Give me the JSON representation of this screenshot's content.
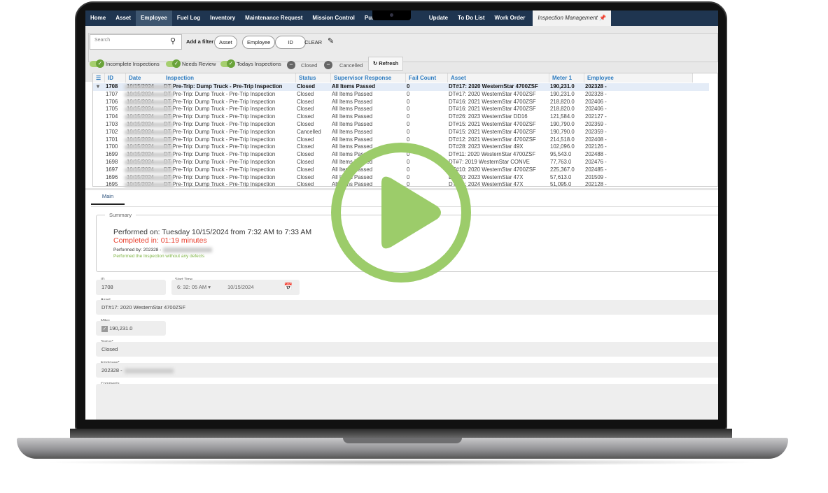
{
  "nav": {
    "items": [
      "Home",
      "Asset",
      "Employee",
      "Fuel Log",
      "Inventory",
      "Maintenance Request",
      "Mission Control",
      "Purchase",
      "Update",
      "To Do List",
      "Work Order"
    ],
    "active_tab": "Inspection Management",
    "selected": "Employee"
  },
  "filters": {
    "search_placeholder": "Search",
    "add_filter": "Add a filter",
    "chips": [
      "Asset",
      "Employee",
      "ID"
    ],
    "clear": "CLEAR",
    "toggles": [
      {
        "label": "Incomplete Inspections",
        "on": true
      },
      {
        "label": "Needs Review",
        "on": true
      },
      {
        "label": "Todays Inspections",
        "on": true
      },
      {
        "label": "Closed",
        "on": false
      },
      {
        "label": "Cancelled",
        "on": false
      }
    ],
    "refresh": "Refresh"
  },
  "grid": {
    "columns": [
      "ID",
      "Date",
      "Inspection",
      "Status",
      "Supervisor Response",
      "Fail Count",
      "Asset",
      "Meter 1",
      "Employee"
    ],
    "rows": [
      [
        "1708",
        "10/15/2024",
        "DT Pre-Trip: Dump Truck - Pre-Trip Inspection",
        "Closed",
        "All Items Passed",
        "0",
        "DT#17: 2020 WesternStar 4700ZSF",
        "190,231.0",
        "202328 -"
      ],
      [
        "1707",
        "10/15/2024",
        "DT Pre-Trip: Dump Truck - Pre-Trip Inspection",
        "Closed",
        "All Items Passed",
        "0",
        "DT#17: 2020 WesternStar 4700ZSF",
        "190,231.0",
        "202328 -"
      ],
      [
        "1706",
        "10/15/2024",
        "DT Pre-Trip: Dump Truck - Pre-Trip Inspection",
        "Closed",
        "All Items Passed",
        "0",
        "DT#16: 2021 WesternStar 4700ZSF",
        "218,820.0",
        "202406 -"
      ],
      [
        "1705",
        "10/15/2024",
        "DT Pre-Trip: Dump Truck - Pre-Trip Inspection",
        "Closed",
        "All Items Passed",
        "0",
        "DT#16: 2021 WesternStar 4700ZSF",
        "218,820.0",
        "202406 -"
      ],
      [
        "1704",
        "10/15/2024",
        "DT Pre-Trip: Dump Truck - Pre-Trip Inspection",
        "Closed",
        "All Items Passed",
        "0",
        "DT#26: 2023 WesternStar DD16",
        "121,584.0",
        "202127 -"
      ],
      [
        "1703",
        "10/15/2024",
        "DT Pre-Trip: Dump Truck - Pre-Trip Inspection",
        "Closed",
        "All Items Passed",
        "0",
        "DT#15: 2021 WesternStar 4700ZSF",
        "190,790.0",
        "202359 -"
      ],
      [
        "1702",
        "10/15/2024",
        "DT Pre-Trip: Dump Truck - Pre-Trip Inspection",
        "Cancelled",
        "All Items Passed",
        "0",
        "DT#15: 2021 WesternStar 4700ZSF",
        "190,790.0",
        "202359 -"
      ],
      [
        "1701",
        "10/15/2024",
        "DT Pre-Trip: Dump Truck - Pre-Trip Inspection",
        "Closed",
        "All Items Passed",
        "0",
        "DT#12: 2021 WesternStar 4700ZSF",
        "214,518.0",
        "202408 -"
      ],
      [
        "1700",
        "10/15/2024",
        "DT Pre-Trip: Dump Truck - Pre-Trip Inspection",
        "Closed",
        "All Items Passed",
        "0",
        "DT#28: 2023 WesternStar 49X",
        "102,096.0",
        "202126 -"
      ],
      [
        "1699",
        "10/15/2024",
        "DT Pre-Trip: Dump Truck - Pre-Trip Inspection",
        "Closed",
        "All Items Passed",
        "0",
        "DT#11: 2020 WesternStar 4700ZSF",
        "95,543.0",
        "202488 -"
      ],
      [
        "1698",
        "10/15/2024",
        "DT Pre-Trip: Dump Truck - Pre-Trip Inspection",
        "Closed",
        "All Items Passed",
        "0",
        "DT#7: 2019 WesternStar CONVE",
        "77,763.0",
        "202476 -"
      ],
      [
        "1697",
        "10/15/2024",
        "DT Pre-Trip: Dump Truck - Pre-Trip Inspection",
        "Closed",
        "All Items Passed",
        "0",
        "DT#10: 2020 WesternStar 4700ZSF",
        "225,367.0",
        "202485 -"
      ],
      [
        "1696",
        "10/15/2024",
        "DT Pre-Trip: Dump Truck - Pre-Trip Inspection",
        "Closed",
        "All Items Passed",
        "0",
        "DT#30: 2023 WesternStar 47X",
        "57,613.0",
        "201509 -"
      ],
      [
        "1695",
        "10/15/2024",
        "DT Pre-Trip: Dump Truck - Pre-Trip Inspection",
        "Closed",
        "All Items Passed",
        "0",
        "DT#31: 2024 WesternStar 47X",
        "51,095.0",
        "202128 -"
      ]
    ]
  },
  "detail": {
    "tab": "Main",
    "summary_legend": "Summary",
    "performed_on": "Performed on: Tuesday 10/15/2024 from 7:32 AM to 7:33 AM",
    "completed_in": "Completed in: 01:19 minutes",
    "performed_by": "Performed by: 202328 -",
    "defects_note": "Performed the Inspection without any defects",
    "fields": {
      "id_label": "ID",
      "id": "1708",
      "start_label": "Start Time",
      "start_time": "6: 32: 05 AM",
      "start_date": "10/15/2024",
      "asset_label": "Asset",
      "asset": "DT#17: 2020 WesternStar 4700ZSF",
      "miles_label": "Miles",
      "miles": "190,231.0",
      "status_label": "Status*",
      "status": "Closed",
      "employee_label": "Employee*",
      "employee": "202328 -",
      "comments_label": "Comments"
    }
  },
  "colors": {
    "nav": "#1f3550",
    "accent": "#2d7cc1",
    "completed": "#e8402f",
    "defects_note": "#7cb342",
    "play": "#9ccc6a"
  }
}
